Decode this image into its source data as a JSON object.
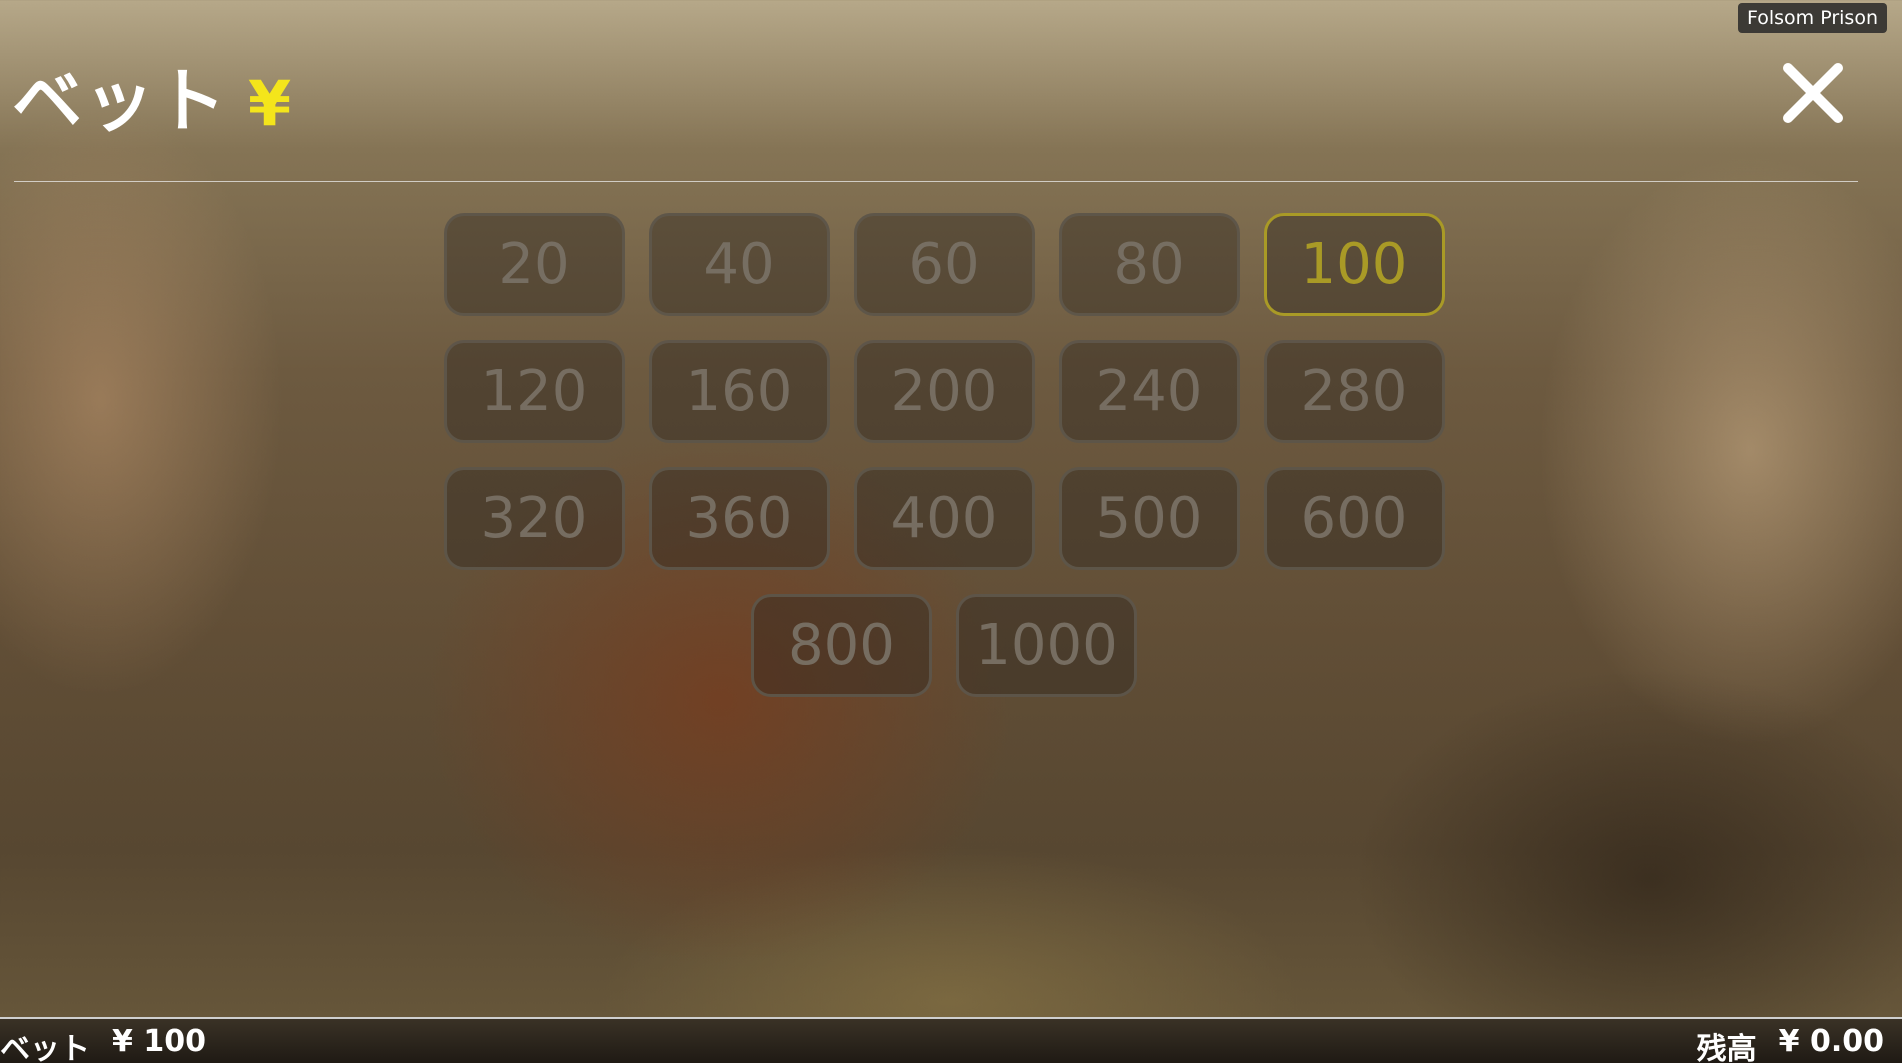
{
  "game_title": "Folsom Prison",
  "header": {
    "label": "ベット",
    "currency": "¥"
  },
  "close_icon": "close-icon",
  "bet_options": {
    "selected": "100",
    "rows": [
      [
        "20",
        "40",
        "60",
        "80",
        "100"
      ],
      [
        "120",
        "160",
        "200",
        "240",
        "280"
      ],
      [
        "320",
        "360",
        "400",
        "500",
        "600"
      ],
      [
        "800",
        "1000"
      ]
    ]
  },
  "footer": {
    "bet_label": "ベット",
    "bet_value": "¥ 100",
    "balance_label": "残高",
    "balance_value": "¥ 0.00"
  },
  "colors": {
    "accent": "#f4e51b",
    "selected_border": "#a99a26"
  }
}
